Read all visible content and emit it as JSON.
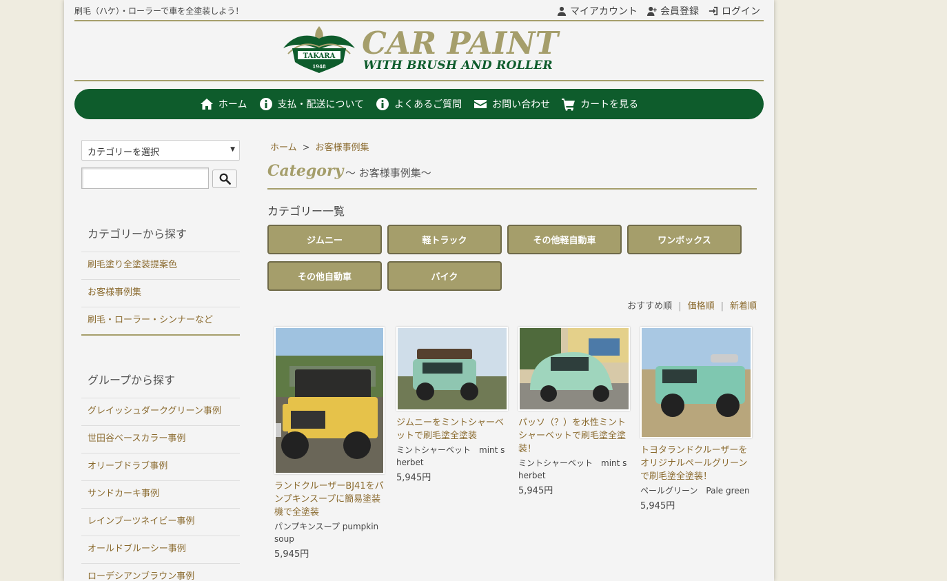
{
  "header": {
    "tagline": "刷毛（ハケ）・ローラーで車を全塗装しよう！",
    "account_links": [
      "マイアカウント",
      "会員登録",
      "ログイン"
    ],
    "logo_main": "CAR PAINT",
    "logo_sub": "WITH BRUSH AND ROLLER",
    "logo_badge": "TAKARA",
    "logo_year": "1948"
  },
  "nav": {
    "items": [
      "ホーム",
      "支払・配送について",
      "よくあるご質問",
      "お問い合わせ",
      "カートを見る"
    ]
  },
  "sidebar": {
    "select_label": "カテゴリーを選択",
    "search_placeholder": "",
    "category_heading": "カテゴリーから探す",
    "categories": [
      "刷毛塗り全塗装提案色",
      "お客様事例集",
      "刷毛・ローラー・シンナーなど"
    ],
    "group_heading": "グループから探す",
    "groups": [
      "グレイッシュダークグリーン事例",
      "世田谷ベースカラー事例",
      "オリーブドラブ事例",
      "サンドカーキ事例",
      "レインブーツネイビー事例",
      "オールドブルーシー事例",
      "ローデシアンブラウン事例"
    ]
  },
  "main": {
    "breadcrumb_home": "ホーム",
    "breadcrumb_sep": ">",
    "breadcrumb_current": "お客様事例集",
    "category_word": "Category",
    "category_sub": "～ お客様事例集～",
    "category_list_heading": "カテゴリー一覧",
    "category_buttons": [
      "ジムニー",
      "軽トラック",
      "その他軽自動車",
      "ワンボックス",
      "その他自動車",
      "バイク"
    ],
    "sort": {
      "current": "おすすめ順",
      "price": "価格順",
      "new": "新着順"
    }
  },
  "products": [
    {
      "name": "ランドクルーザーBJ41をパンプキンスープに簡易塗装機で全塗装",
      "desc": "パンプキンスープ pumpkin soup",
      "price": "5,945円",
      "car_color": "#e9c54a"
    },
    {
      "name": "ジムニーをミントシャーベットで刷毛塗全塗装",
      "desc": "ミントシャーベット　mint sherbet",
      "price": "5,945円",
      "car_color": "#8fc6b1"
    },
    {
      "name": "パッソ（？）を水性ミントシャーベットで刷毛塗全塗装！",
      "desc": "ミントシャーベット　mint sherbet",
      "price": "5,945円",
      "car_color": "#9fd5bd"
    },
    {
      "name": "トヨタランドクルーザーをオリジナルペールグリーンで刷毛塗全塗装！",
      "desc": "ペールグリーン　Pale green",
      "price": "5,945円",
      "car_color": "#7fc7b0"
    }
  ]
}
